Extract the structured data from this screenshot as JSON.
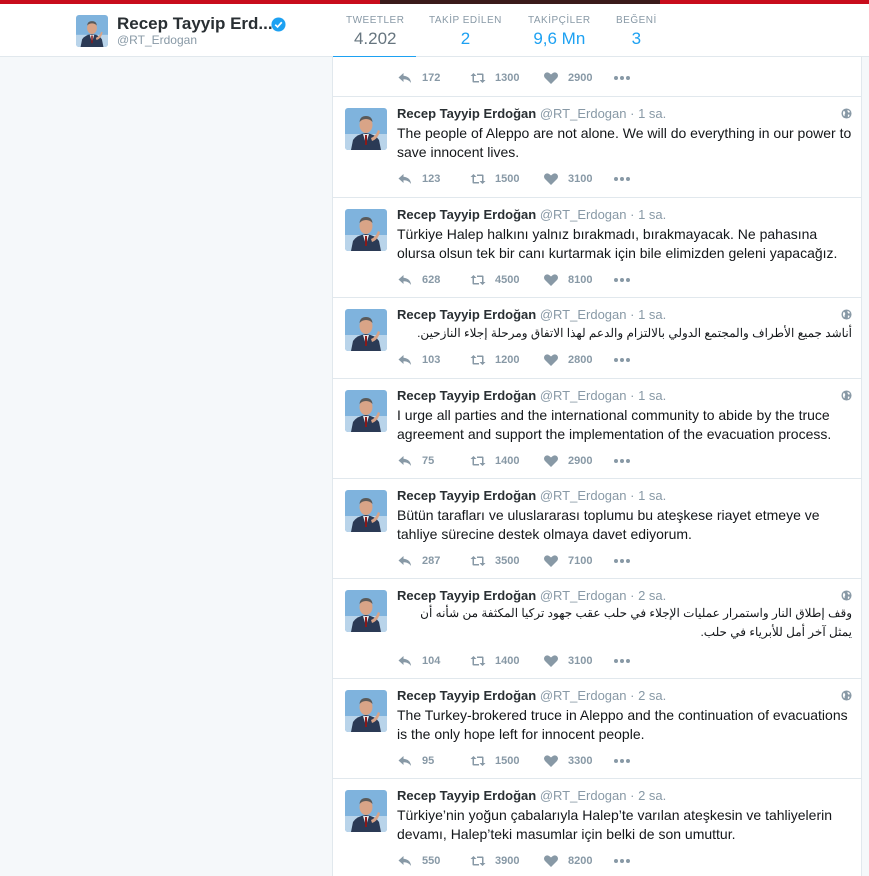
{
  "profile": {
    "name": "Recep Tayyip Erd...",
    "handle": "@RT_Erdogan",
    "stats": [
      {
        "label": "TWEETLER",
        "value": "4.202"
      },
      {
        "label": "TAKİP EDİLEN",
        "value": "2"
      },
      {
        "label": "TAKİPÇİLER",
        "value": "9,6 Mn"
      },
      {
        "label": "BEĞENİ",
        "value": "3"
      }
    ]
  },
  "colors": {
    "accent": "#1da1f2",
    "muted": "#8899a6",
    "top_band": "#c80c1c"
  },
  "partial_tweet": {
    "replies": "172",
    "retweets": "1300",
    "likes": "2900"
  },
  "tweets": [
    {
      "name": "Recep Tayyip Erdoğan",
      "handle": "@RT_Erdogan",
      "sep": "·",
      "time": "1 sa.",
      "text": "The people of Aleppo are not alone. We will do everything in our power to save innocent lives.",
      "replies": "123",
      "retweets": "1500",
      "likes": "3100"
    },
    {
      "name": "Recep Tayyip Erdoğan",
      "handle": "@RT_Erdogan",
      "sep": "·",
      "time": "1 sa.",
      "text": "Türkiye Halep halkını yalnız bırakmadı, bırakmayacak. Ne pahasına olursa olsun tek bir canı kurtarmak için bile elimizden geleni yapacağız.",
      "replies": "628",
      "retweets": "4500",
      "likes": "8100"
    },
    {
      "name": "Recep Tayyip Erdoğan",
      "handle": "@RT_Erdogan",
      "sep": "·",
      "time": "1 sa.",
      "text": "أناشد جميع الأطراف والمجتمع الدولي بالالتزام والدعم لهذا الاتفاق ومرحلة إجلاء النازحين.",
      "replies": "103",
      "retweets": "1200",
      "likes": "2800"
    },
    {
      "name": "Recep Tayyip Erdoğan",
      "handle": "@RT_Erdogan",
      "sep": "·",
      "time": "1 sa.",
      "text": "I urge all parties and the international community to abide by the truce agreement and support the implementation of the evacuation process.",
      "replies": "75",
      "retweets": "1400",
      "likes": "2900"
    },
    {
      "name": "Recep Tayyip Erdoğan",
      "handle": "@RT_Erdogan",
      "sep": "·",
      "time": "1 sa.",
      "text": "Bütün tarafları ve uluslararası toplumu bu ateşkese riayet etmeye ve tahliye sürecine destek olmaya davet ediyorum.",
      "replies": "287",
      "retweets": "3500",
      "likes": "7100"
    },
    {
      "name": "Recep Tayyip Erdoğan",
      "handle": "@RT_Erdogan",
      "sep": "·",
      "time": "2 sa.",
      "text": "وقف إطلاق النار واستمرار عمليات الإجلاء في حلب عقب جهود تركيا المكثفة من شأنه أن يمثل آخر أمل للأبرياء في حلب.",
      "replies": "104",
      "retweets": "1400",
      "likes": "3100"
    },
    {
      "name": "Recep Tayyip Erdoğan",
      "handle": "@RT_Erdogan",
      "sep": "·",
      "time": "2 sa.",
      "text": "The Turkey-brokered truce in Aleppo and the continuation of evacuations is the only hope left for innocent people.",
      "replies": "95",
      "retweets": "1500",
      "likes": "3300"
    },
    {
      "name": "Recep Tayyip Erdoğan",
      "handle": "@RT_Erdogan",
      "sep": "·",
      "time": "2 sa.",
      "text": "Türkiye’nin yoğun çabalarıyla Halep’te varılan ateşkesin ve tahliyelerin devamı, Halep’teki masumlar için belki de son umuttur.",
      "replies": "550",
      "retweets": "3900",
      "likes": "8200"
    }
  ]
}
